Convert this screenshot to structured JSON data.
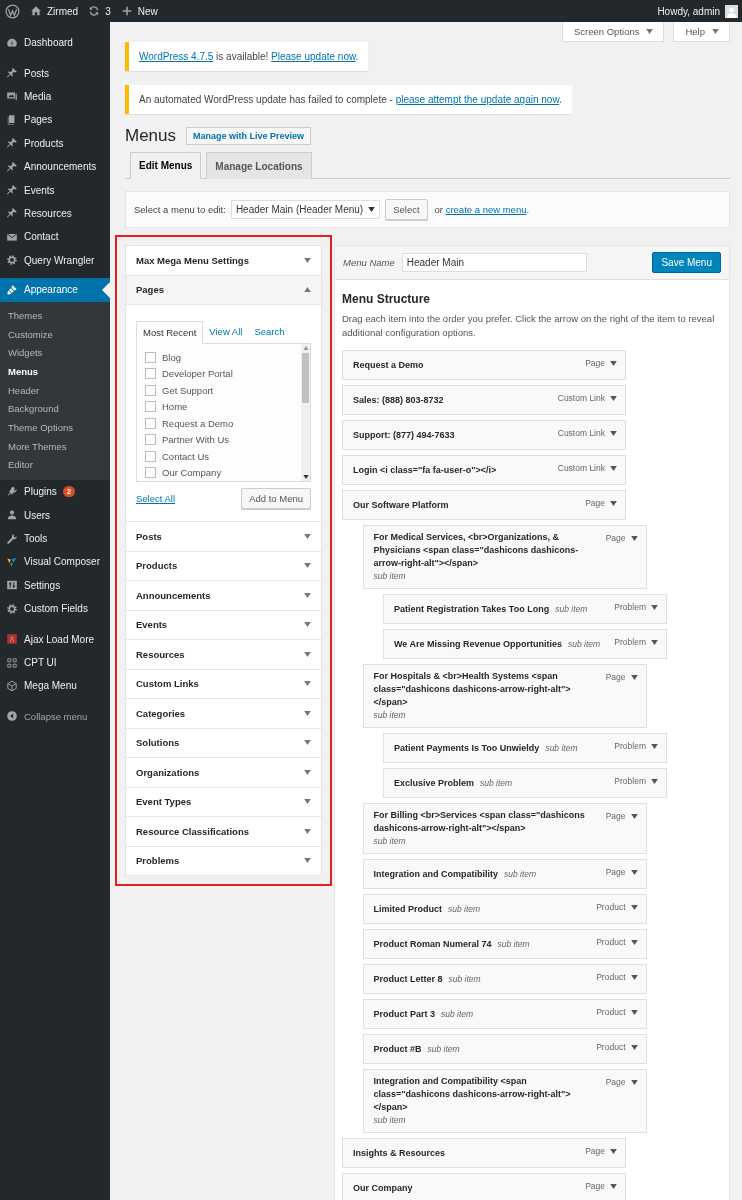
{
  "admin_bar": {
    "site": "Zirmed",
    "updates": "3",
    "new": "New",
    "greeting": "Howdy, admin"
  },
  "screen_meta": [
    "Screen Options",
    "Help"
  ],
  "sidebar": {
    "groups": [
      [
        {
          "label": "Dashboard",
          "selected": false
        }
      ],
      [
        {
          "label": "Posts",
          "selected": false
        },
        {
          "label": "Media",
          "selected": false
        },
        {
          "label": "Pages",
          "selected": false
        },
        {
          "label": "Products",
          "selected": false
        },
        {
          "label": "Announcements",
          "selected": false
        },
        {
          "label": "Events",
          "selected": false
        },
        {
          "label": "Resources",
          "selected": false
        },
        {
          "label": "Contact",
          "selected": false
        },
        {
          "label": "Query Wrangler",
          "selected": false
        },
        {
          "label": "Appearance",
          "selected": true,
          "submenu": [
            {
              "label": "Themes",
              "selected": false
            },
            {
              "label": "Customize",
              "selected": false
            },
            {
              "label": "Widgets",
              "selected": false
            },
            {
              "label": "Menus",
              "selected": true
            },
            {
              "label": "Header",
              "selected": false
            },
            {
              "label": "Background",
              "selected": false
            },
            {
              "label": "Theme Options",
              "selected": false
            },
            {
              "label": "More Themes",
              "selected": false
            },
            {
              "label": "Editor",
              "selected": false
            }
          ]
        },
        {
          "label": "Plugins",
          "selected": false,
          "badge": "2"
        },
        {
          "label": "Users",
          "selected": false
        },
        {
          "label": "Tools",
          "selected": false
        },
        {
          "label": "Visual Composer",
          "selected": false
        },
        {
          "label": "Settings",
          "selected": false
        },
        {
          "label": "Custom Fields",
          "selected": false
        }
      ],
      [
        {
          "label": "Ajax Load More",
          "selected": false
        },
        {
          "label": "CPT UI",
          "selected": false
        },
        {
          "label": "Mega Menu",
          "selected": false
        }
      ]
    ],
    "collapse": "Collapse menu"
  },
  "notices": [
    [
      {
        "text": "WordPress 4.7.5",
        "link": true
      },
      {
        "text": " is available! ",
        "link": false
      },
      {
        "text": "Please update now",
        "link": true
      },
      {
        "text": ".",
        "link": false
      }
    ],
    [
      {
        "text": "An automated WordPress update has failed to complete - ",
        "link": false
      },
      {
        "text": "please attempt the update again now",
        "link": true
      },
      {
        "text": ".",
        "link": false
      }
    ]
  ],
  "page_title": "Menus",
  "title_action": "Manage with Live Preview",
  "tabs": [
    {
      "label": "Edit Menus",
      "selected": true
    },
    {
      "label": "Manage Locations",
      "selected": false
    }
  ],
  "menu_select": {
    "label": "Select a menu to edit:",
    "value": "Header Main (Header Menu)",
    "button": "Select",
    "after": [
      {
        "text": "or ",
        "link": false
      },
      {
        "text": "create a new menu",
        "link": true
      },
      {
        "text": ".",
        "link": false
      }
    ]
  },
  "left_panel": {
    "sections": [
      {
        "title": "Max Mega Menu Settings",
        "expanded": false
      },
      {
        "title": "Pages",
        "expanded": true,
        "tabs": [
          {
            "label": "Most Recent",
            "selected": true
          },
          {
            "label": "View All",
            "selected": false
          },
          {
            "label": "Search",
            "selected": false
          }
        ],
        "items": [
          {
            "label": "Blog",
            "checked": false
          },
          {
            "label": "Developer Portal",
            "checked": false
          },
          {
            "label": "Get Support",
            "checked": false
          },
          {
            "label": "Home",
            "checked": false
          },
          {
            "label": "Request a Demo",
            "checked": false
          },
          {
            "label": "Partner With Us",
            "checked": false
          },
          {
            "label": "Contact Us",
            "checked": false
          },
          {
            "label": "Our Company",
            "checked": false
          }
        ],
        "select_all": "Select All",
        "add_button": "Add to Menu"
      },
      {
        "title": "Posts",
        "expanded": false
      },
      {
        "title": "Products",
        "expanded": false
      },
      {
        "title": "Announcements",
        "expanded": false
      },
      {
        "title": "Events",
        "expanded": false
      },
      {
        "title": "Resources",
        "expanded": false
      },
      {
        "title": "Custom Links",
        "expanded": false
      },
      {
        "title": "Categories",
        "expanded": false
      },
      {
        "title": "Solutions",
        "expanded": false
      },
      {
        "title": "Organizations",
        "expanded": false
      },
      {
        "title": "Event Types",
        "expanded": false
      },
      {
        "title": "Resource Classifications",
        "expanded": false
      },
      {
        "title": "Problems",
        "expanded": false
      }
    ]
  },
  "menu_editor": {
    "name_label": "Menu Name",
    "name_value": "Header Main",
    "save": "Save Menu",
    "heading": "Menu Structure",
    "description": "Drag each item into the order you prefer. Click the arrow on the right of the item to reveal additional configuration options.",
    "items": [
      {
        "title": "Request a Demo",
        "type": "Page"
      },
      {
        "title": "Sales: (888) 803-8732",
        "type": "Custom Link"
      },
      {
        "title": "Support: (877) 494-7633",
        "type": "Custom Link"
      },
      {
        "title": "Login <i class=\"fa fa-user-o\"></i>",
        "type": "Custom Link"
      },
      {
        "title": "Our Software Platform",
        "type": "Page",
        "children": [
          {
            "title": "For Medical Services, <br>Organizations, & Physicians <span class=\"dashicons dashicons-arrow-right-alt\"></span>",
            "note": "sub item",
            "type": "Page",
            "children": [
              {
                "title": "Patient Registration Takes Too Long",
                "note": "sub item",
                "type": "Problem"
              },
              {
                "title": "We Are Missing Revenue Opportunities",
                "note": "sub item",
                "type": "Problem"
              }
            ]
          },
          {
            "title": "For Hospitals & <br>Health Systems <span class=\"dashicons dashicons-arrow-right-alt\"></span>",
            "note": "sub item",
            "type": "Page",
            "children": [
              {
                "title": "Patient Payments Is Too Unwieldy",
                "note": "sub item",
                "type": "Problem"
              },
              {
                "title": "Exclusive Problem",
                "note": "sub item",
                "type": "Problem"
              }
            ]
          },
          {
            "title": "For Billing <br>Services <span class=\"dashicons dashicons-arrow-right-alt\"></span>",
            "note": "sub item",
            "type": "Page"
          },
          {
            "title": "Integration and Compatibility",
            "note": "sub item",
            "type": "Page"
          },
          {
            "title": "Limited Product",
            "note": "sub item",
            "type": "Product"
          },
          {
            "title": "Product Roman Numeral 74",
            "note": "sub item",
            "type": "Product"
          },
          {
            "title": "Product Letter 8",
            "note": "sub item",
            "type": "Product"
          },
          {
            "title": "Product Part 3",
            "note": "sub item",
            "type": "Product"
          },
          {
            "title": "Product #B",
            "note": "sub item",
            "type": "Product"
          },
          {
            "title": "Integration and Compatibility <span class=\"dashicons dashicons-arrow-right-alt\"></span>",
            "note": "sub item",
            "type": "Page"
          }
        ]
      },
      {
        "title": "Insights & Resources",
        "type": "Page"
      },
      {
        "title": "Our Company",
        "type": "Page"
      }
    ]
  }
}
